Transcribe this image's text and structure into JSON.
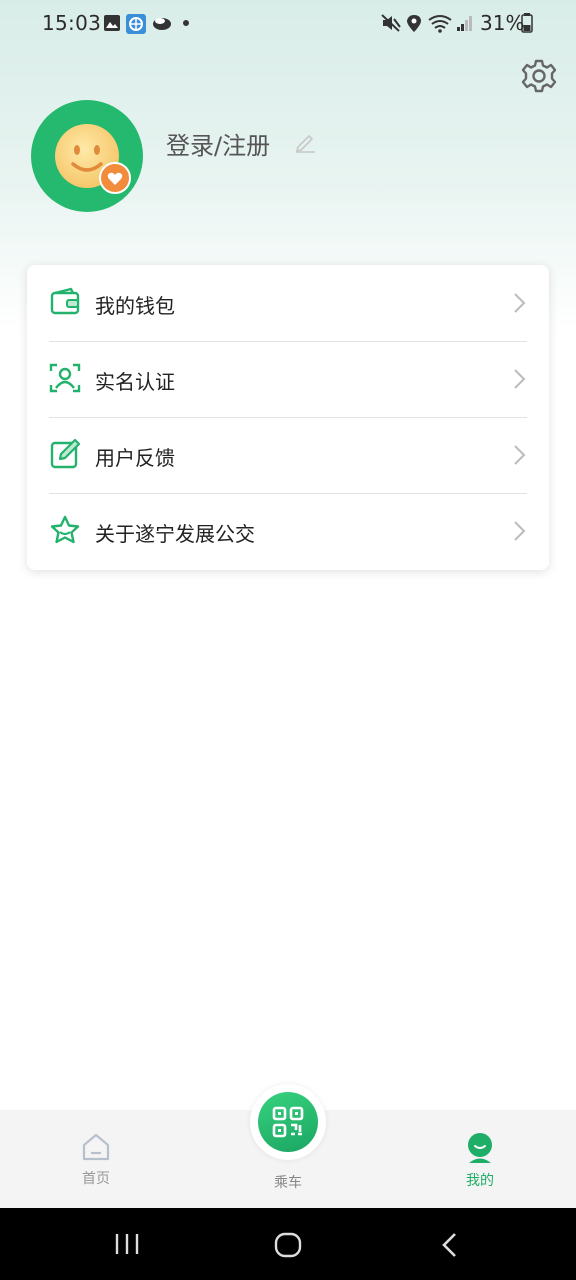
{
  "status_bar": {
    "time": "15:03",
    "battery": "31%"
  },
  "profile": {
    "login_label": "登录/注册"
  },
  "menu": {
    "items": [
      {
        "label": "我的钱包",
        "icon": "wallet-icon"
      },
      {
        "label": "实名认证",
        "icon": "id-verify-icon"
      },
      {
        "label": "用户反馈",
        "icon": "feedback-edit-icon"
      },
      {
        "label": "关于遂宁发展公交",
        "icon": "star-icon"
      }
    ]
  },
  "bottom_nav": {
    "home_label": "首页",
    "ride_label": "乘车",
    "mine_label": "我的",
    "active": "mine"
  },
  "colors": {
    "brand_green": "#25b96f",
    "active_tab": "#1fae67",
    "inactive_tab": "#999999",
    "avatar_badge": "#f28b3c"
  }
}
